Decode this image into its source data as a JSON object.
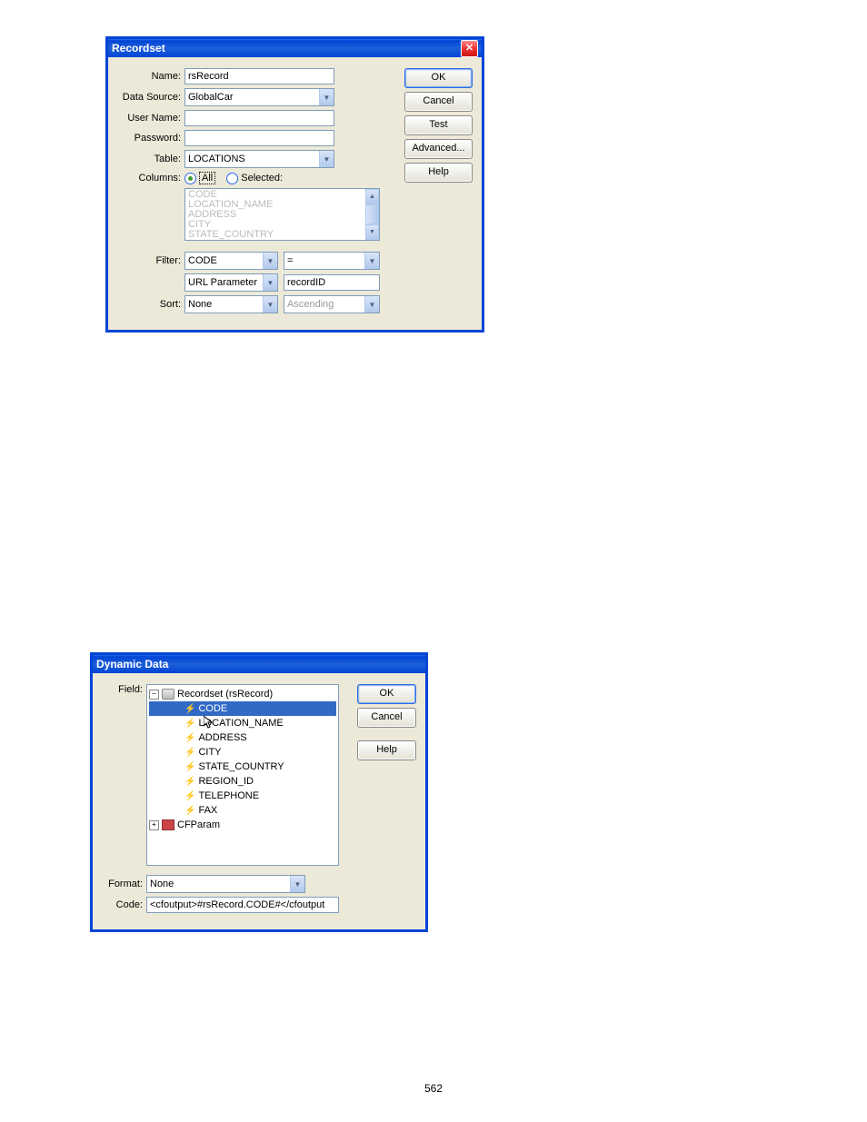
{
  "page_number": "562",
  "recordset": {
    "title": "Recordset",
    "labels": {
      "name": "Name:",
      "datasource": "Data Source:",
      "username": "User Name:",
      "password": "Password:",
      "table": "Table:",
      "columns": "Columns:",
      "filter": "Filter:",
      "sort": "Sort:",
      "all": "All",
      "selected": "Selected:"
    },
    "name": "rsRecord",
    "datasource": "GlobalCar",
    "username": "",
    "password": "",
    "table": "LOCATIONS",
    "column_list": [
      "CODE",
      "LOCATION_NAME",
      "ADDRESS",
      "CITY",
      "STATE_COUNTRY"
    ],
    "filter_field": "CODE",
    "filter_op": "=",
    "filter_ptype": "URL Parameter",
    "filter_pval": "recordID",
    "sort_field": "None",
    "sort_dir": "Ascending",
    "buttons": {
      "ok": "OK",
      "cancel": "Cancel",
      "test": "Test",
      "advanced": "Advanced...",
      "help": "Help"
    }
  },
  "dynamic": {
    "title": "Dynamic Data",
    "labels": {
      "field": "Field:",
      "format": "Format:",
      "code": "Code:"
    },
    "tree_root": "Recordset (rsRecord)",
    "tree_items": [
      "CODE",
      "LOCATION_NAME",
      "ADDRESS",
      "CITY",
      "STATE_COUNTRY",
      "REGION_ID",
      "TELEPHONE",
      "FAX"
    ],
    "tree_param": "CFParam",
    "format": "None",
    "code": "<cfoutput>#rsRecord.CODE#</cfoutput",
    "buttons": {
      "ok": "OK",
      "cancel": "Cancel",
      "help": "Help"
    }
  }
}
